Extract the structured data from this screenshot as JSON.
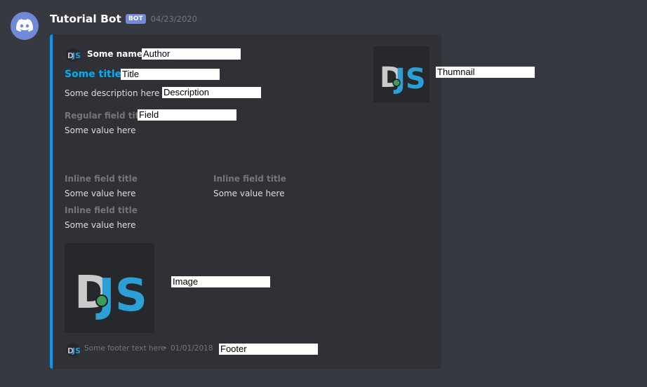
{
  "message": {
    "username": "Tutorial Bot",
    "bot_badge": "BOT",
    "timestamp": "04/23/2020"
  },
  "embed": {
    "accent_color": "#0099ff",
    "author_name": "Some name",
    "title": "Some title",
    "description": "Some description here",
    "fields": [
      {
        "name": "Regular field title",
        "value": "Some value here"
      },
      {
        "name": "Inline field title",
        "value": "Some value here"
      },
      {
        "name": "Inline field title",
        "value": "Some value here"
      },
      {
        "name": "Inline field title",
        "value": "Some value here"
      }
    ],
    "footer_text": "Some footer text here",
    "footer_separator": "•",
    "footer_timestamp": "01/01/2018",
    "thumbnail_icon": "djs-logo",
    "image_icon": "djs-logo"
  },
  "callouts": {
    "author": "Author",
    "title": "Title",
    "description": "Description",
    "field": "Field",
    "thumbnail": "Thumnail",
    "image": "Image",
    "footer": "Footer"
  }
}
